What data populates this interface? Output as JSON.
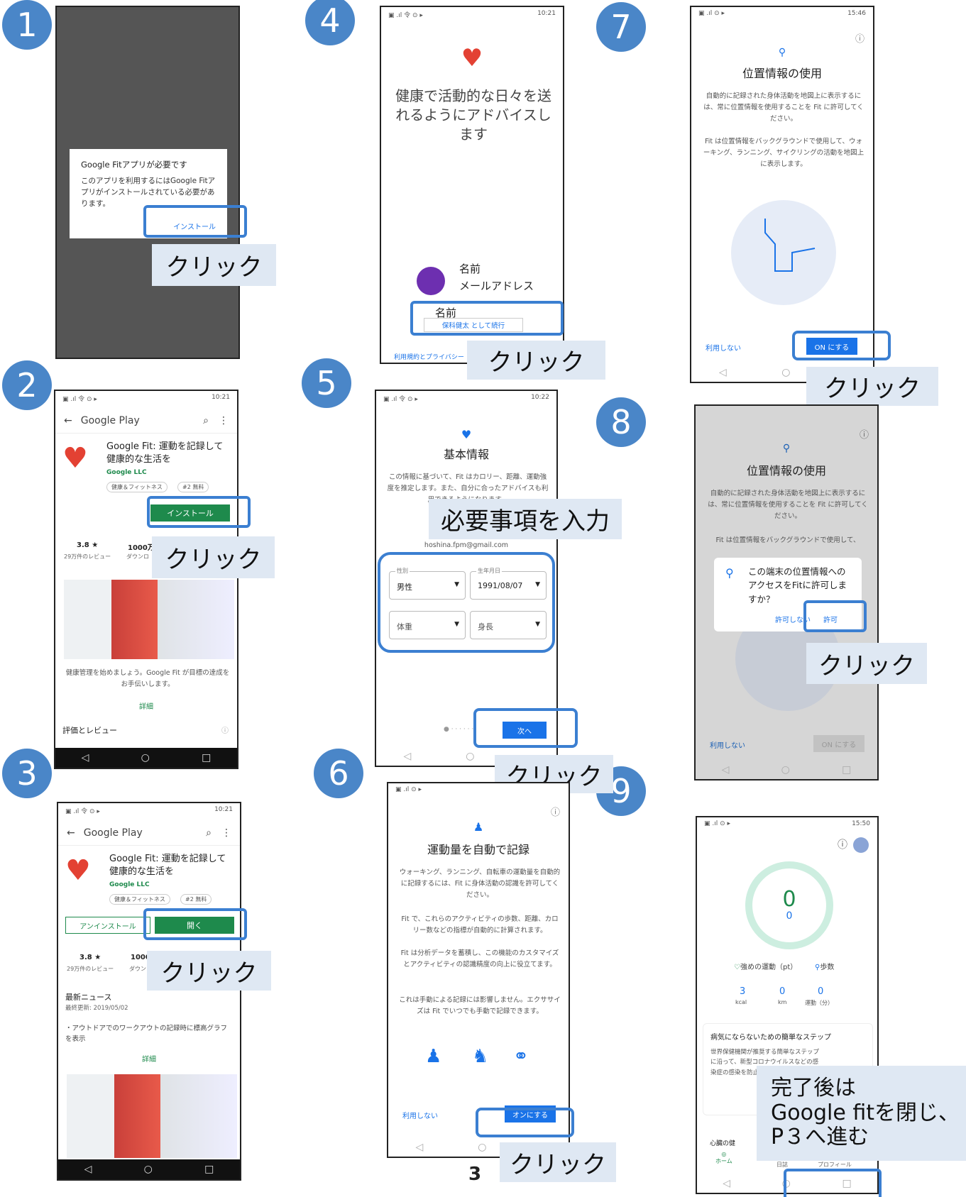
{
  "click_label": "クリック",
  "page_number": "3",
  "steps": [
    "1",
    "2",
    "3",
    "4",
    "5",
    "6",
    "7",
    "8",
    "9"
  ],
  "s1": {
    "dialog_title": "Google Fitアプリが必要です",
    "dialog_body": "このアプリを利用するにはGoogle Fitアプリがインストールされている必要があります。",
    "install": "インストール"
  },
  "store": {
    "app_bar": "Google Play",
    "app_title": "Google Fit: 運動を記録して健康的な生活を",
    "developer": "Google LLC",
    "tag1": "健康＆フィットネス",
    "tag2": "#2 無料",
    "install": "インストール",
    "rating": "3.8 ★",
    "reviews": "29万件のレビュー",
    "downloads": "1000万",
    "downloads_label": "ダウンロ",
    "downloads_short": "1000",
    "downloads_label_short": "ダウン",
    "promo": "健康管理を始めましょう。Google Fit が目標の達成をお手伝いします。",
    "details": "詳細",
    "reviews_header": "評価とレビュー",
    "uninstall": "アンインストール",
    "open": "開く",
    "news_title": "最新ニュース",
    "news_date": "最終更新: 2019/05/02",
    "news_body": "・アウトドアでのワークアウトの記録時に標高グラフを表示",
    "time1": "10:21"
  },
  "s4": {
    "headline": "健康で活動的な日々を送れるようにアドバイスします",
    "name": "名前",
    "email": "メールアドレス",
    "name2": "名前",
    "continue": "保科健太 として続行",
    "terms": "利用規約とプライバシー",
    "time": "10:21"
  },
  "s5": {
    "title": "基本情報",
    "desc": "この情報に基づいて、Fit はカロリー、距離、運動強度を推定します。また、自分に合ったアドバイスも利用できるようになります。",
    "callout": "必要事項を入力",
    "email": "hoshina.fpm@gmail.com",
    "gender_label": "性別",
    "gender": "男性",
    "dob_label": "生年月日",
    "dob": "1991/08/07",
    "weight": "体重",
    "height": "身長",
    "next": "次へ",
    "time": "10:22"
  },
  "s6": {
    "title": "運動量を自動で記録",
    "p1": "ウォーキング、ランニング、自転車の運動量を自動的に記録するには、Fit に身体活動の認識を許可してください。",
    "p2": "Fit で、これらのアクティビティの歩数、距離、カロリー数などの指標が自動的に計算されます。",
    "p3": "Fit は分析データを蓄積し、この機能のカスタマイズとアクティビティの認識精度の向上に役立てます。",
    "p4": "これは手動による記録には影響しません。エクササイズは Fit でいつでも手動で記録できます。",
    "decline": "利用しない",
    "on": "オンにする"
  },
  "s7": {
    "title": "位置情報の使用",
    "p1": "自動的に記録された身体活動を地図上に表示するには、常に位置情報を使用することを Fit に許可してください。",
    "p2": "Fit は位置情報をバックグラウンドで使用して、ウォーキング、ランニング、サイクリングの活動を地図上に表示します。",
    "decline": "利用しない",
    "on": "ON にする",
    "time": "15:46"
  },
  "s8": {
    "title": "位置情報の使用",
    "p1": "自動的に記録された身体活動を地図上に表示するには、常に位置情報を使用することを Fit に許可してください。",
    "p2": "Fit は位置情報をバックグラウンドで使用して、",
    "dialog": "この端末の位置情報へのアクセスをFitに許可しますか？",
    "deny": "許可しない",
    "allow": "許可",
    "decline": "利用しない",
    "on": "ON にする"
  },
  "s9": {
    "ring_big": "0",
    "ring_small": "0",
    "heart_label": "強めの運動（pt）",
    "steps_label": "歩数",
    "kcal_val": "3",
    "kcal": "kcal",
    "km_val": "0",
    "km": "km",
    "min_val": "0",
    "min": "運動（分）",
    "card_title": "病気にならないための簡単なステップ",
    "card_body": "世界保健機関が推奨する簡単なステップに沿って、新型コロナウイルスなどの感染症の感染を防止しましょう",
    "heart_card": "心臓の健",
    "home": "ホーム",
    "journal": "日誌",
    "profile": "プロフィール",
    "callout": "完了後は\nGoogle fitを閉じ、\nP３へ進む",
    "time": "15:50"
  }
}
